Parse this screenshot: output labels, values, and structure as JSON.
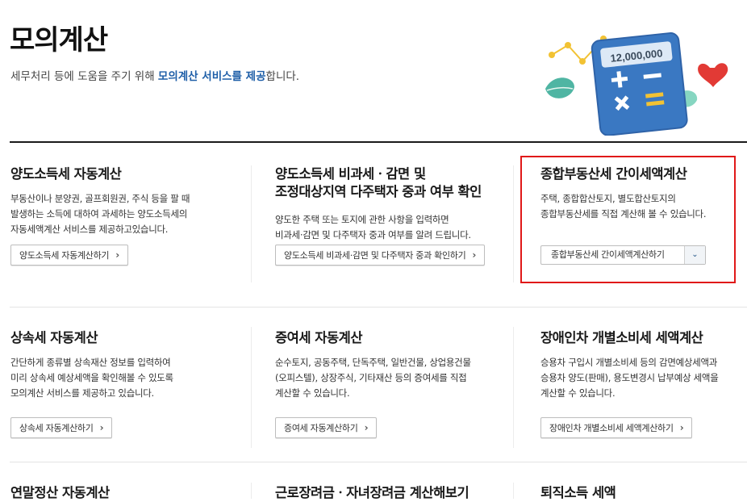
{
  "header": {
    "title": "모의계산",
    "subtitle_prefix": "세무처리 등에 도움을 주기 위해 ",
    "subtitle_highlight": "모의계산 서비스를 제공",
    "subtitle_suffix": "합니다."
  },
  "hero": {
    "calculator_display": "12,000,000"
  },
  "cards": [
    {
      "title": "양도소득세 자동계산",
      "desc": [
        "부동산이나 분양권, 골프회원권, 주식 등을 팔 때",
        "발생하는 소득에 대하여 과세하는 양도소득세의",
        "자동세액계산 서비스를 제공하고있습니다."
      ],
      "button": "양도소득세 자동계산하기"
    },
    {
      "title_lines": [
        "양도소득세 비과세ㆍ감면 및",
        "조정대상지역 다주택자 중과 여부 확인"
      ],
      "desc": [
        "양도한 주택 또는 토지에 관한 사항을 입력하면",
        "비과세·감면 및 다주택자 중과 여부를 알려 드립니다."
      ],
      "button": "양도소득세 비과세·감면 및 다주택자 중과 확인하기"
    },
    {
      "title": "종합부동산세 간이세액계산",
      "desc": [
        "주택, 종합합산토지, 별도합산토지의",
        "종합부동산세를 직접 계산해 볼 수 있습니다."
      ],
      "button": "종합부동산세 간이세액계산하기"
    },
    {
      "title": "상속세 자동계산",
      "desc": [
        "간단하게 종류별 상속재산 정보를 입력하여",
        "미리 상속세 예상세액을 확인해볼 수 있도록",
        "모의계산 서비스를 제공하고 있습니다."
      ],
      "button": "상속세 자동계산하기"
    },
    {
      "title": "증여세 자동계산",
      "desc": [
        "순수토지, 공동주택, 단독주택, 일반건물, 상업용건물",
        "(오피스텔), 상장주식, 기타재산 등의 증여세를 직접",
        "계산할 수 있습니다."
      ],
      "button": "증여세 자동계산하기"
    },
    {
      "title": "장애인차 개별소비세 세액계산",
      "desc": [
        "승용차 구입시 개별소비세 등의 감면예상세액과",
        "승용차 양도(판매), 용도변경시 납부예상 세액을",
        "계산할 수 있습니다."
      ],
      "button": "장애인차 개별소비세 세액계산하기"
    },
    {
      "title": "연말정산 자동계산"
    },
    {
      "title": "근로장려금ㆍ자녀장려금 계산해보기"
    },
    {
      "title": "퇴직소득 세액"
    }
  ],
  "colors": {
    "highlight_border": "#e01919",
    "link_blue": "#1f5fa8"
  }
}
